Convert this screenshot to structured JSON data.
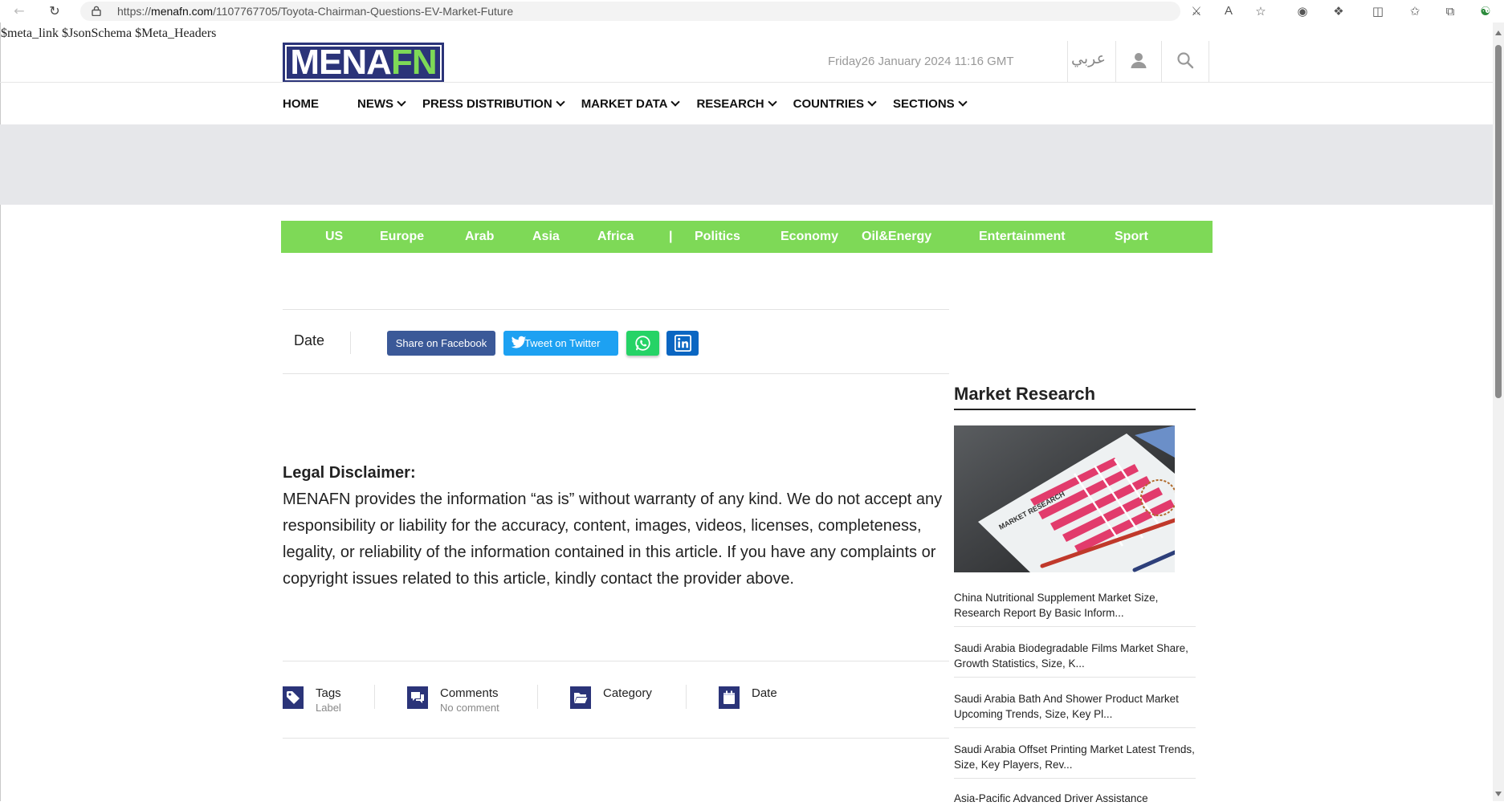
{
  "browser": {
    "url_prefix": "https://",
    "url_domain": "menafn.com",
    "url_path": "/1107767705/Toyota-Chairman-Questions-EV-Market-Future"
  },
  "meta_text": "$meta_link $JsonSchema $Meta_Headers",
  "header": {
    "logo_part1": "MENA",
    "logo_part2": "FN",
    "date": "Friday26 January 2024 11:16 GMT",
    "arabic_label": "عربي"
  },
  "main_nav": [
    {
      "label": "HOME"
    },
    {
      "label": "NEWS"
    },
    {
      "label": "PRESS DISTRIBUTION"
    },
    {
      "label": "MARKET DATA"
    },
    {
      "label": "RESEARCH"
    },
    {
      "label": "COUNTRIES"
    },
    {
      "label": "SECTIONS"
    }
  ],
  "category_bar": [
    "US",
    "Europe",
    "Arab",
    "Asia",
    "Africa",
    "|",
    "Politics",
    "Economy",
    "Oil&Energy",
    "Entertainment",
    "Sport"
  ],
  "share": {
    "date_label": "Date",
    "facebook_label": "Share on Facebook",
    "twitter_label": "Tweet on Twitter"
  },
  "disclaimer": {
    "title": "Legal Disclaimer:",
    "body": "MENAFN provides the information “as is” without warranty of any kind. We do not accept any responsibility or liability for the accuracy, content, images, videos, licenses, completeness, legality, or reliability of the information contained in this article. If you have any complaints or copyright issues related to this article, kindly contact the provider above."
  },
  "meta": {
    "tags_label": "Tags",
    "tags_sub": "Label",
    "comments_label": "Comments",
    "comments_sub": "No comment",
    "category_label": "Category",
    "date_label": "Date"
  },
  "sidebar": {
    "title": "Market Research",
    "image_caption": "MARKET RESEARCH",
    "items": [
      "China Nutritional Supplement Market Size, Research Report By Basic Inform...",
      "Saudi Arabia Biodegradable Films Market Share, Growth Statistics, Size, K...",
      "Saudi Arabia Bath And Shower Product Market Upcoming Trends, Size, Key Pl...",
      "Saudi Arabia Offset Printing Market Latest Trends, Size, Key Players, Rev...",
      "Asia-Pacific Advanced Driver Assistance"
    ]
  },
  "colors": {
    "brand_navy": "#2b3479",
    "brand_green": "#7ed957",
    "facebook": "#3b5998",
    "twitter": "#1da1f2",
    "whatsapp": "#25d366",
    "linkedin": "#0a66c2"
  }
}
